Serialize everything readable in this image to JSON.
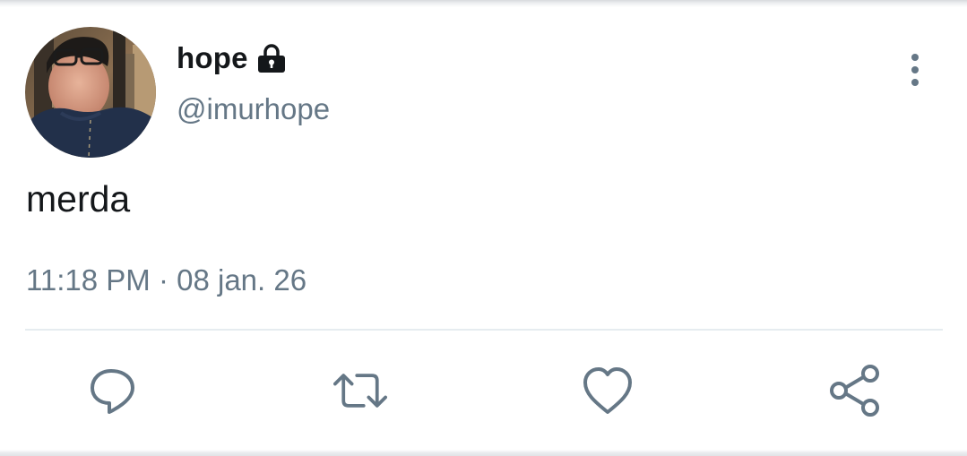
{
  "tweet": {
    "author": {
      "display_name": "hope",
      "handle": "@imurhope",
      "protected_icon": "lock-icon",
      "avatar": "profile-photo"
    },
    "text": "merda",
    "timestamp": "11:18 PM · 08 jan. 26",
    "more_icon": "vertical-ellipsis-icon"
  },
  "actions": [
    {
      "name": "reply",
      "icon": "speech-bubble-icon"
    },
    {
      "name": "retweet",
      "icon": "retweet-arrows-icon"
    },
    {
      "name": "like",
      "icon": "heart-icon"
    },
    {
      "name": "share",
      "icon": "share-nodes-icon"
    }
  ],
  "colors": {
    "text_primary": "#14171a",
    "text_secondary": "#657786",
    "icon": "#657786",
    "divider": "#e6ecf0"
  }
}
